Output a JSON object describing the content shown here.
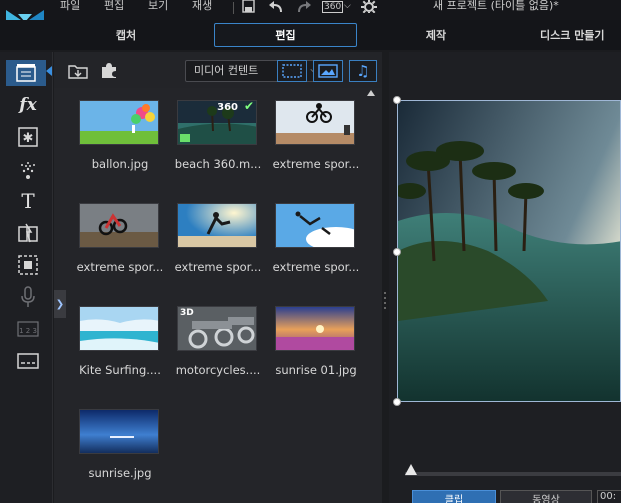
{
  "menu": {
    "file": "파일",
    "edit": "편집",
    "view": "보기",
    "playback": "재생",
    "label_360": "360"
  },
  "window_title": "새 프로젝트 (타이틀 없음)*",
  "tabs": [
    {
      "label": "캡처",
      "active": false
    },
    {
      "label": "편집",
      "active": true
    },
    {
      "label": "제작",
      "active": false
    },
    {
      "label": "디스크 만들기",
      "active": false
    }
  ],
  "toolstrip": [
    "media-room",
    "fx-room",
    "particle-room",
    "magic-room",
    "title-room",
    "transition-room",
    "pip-room",
    "voice-record-room",
    "chapter-room",
    "subtitle-room"
  ],
  "library": {
    "media_filter": "미디어 컨텐트",
    "items": [
      {
        "name": "ballon.jpg",
        "thumb": "balloon"
      },
      {
        "name": "beach 360.m...",
        "thumb": "beach",
        "badge": "360"
      },
      {
        "name": "extreme spor...",
        "thumb": "bike1"
      },
      {
        "name": "extreme spor...",
        "thumb": "bike2"
      },
      {
        "name": "extreme spor...",
        "thumb": "skate"
      },
      {
        "name": "extreme spor...",
        "thumb": "sky"
      },
      {
        "name": "Kite Surfing....",
        "thumb": "kite"
      },
      {
        "name": "motorcycles....",
        "thumb": "moto",
        "badge": "3D"
      },
      {
        "name": "sunrise 01.jpg",
        "thumb": "sunrise1"
      },
      {
        "name": "sunrise.jpg",
        "thumb": "sunrise2"
      }
    ]
  },
  "preview": {
    "clip_label": "클립",
    "movie_label": "동영상",
    "timecode": "00:"
  },
  "colors": {
    "accent": "#3a84c9",
    "active_tool": "#2b5b8c",
    "background": "#1b1c1f"
  }
}
